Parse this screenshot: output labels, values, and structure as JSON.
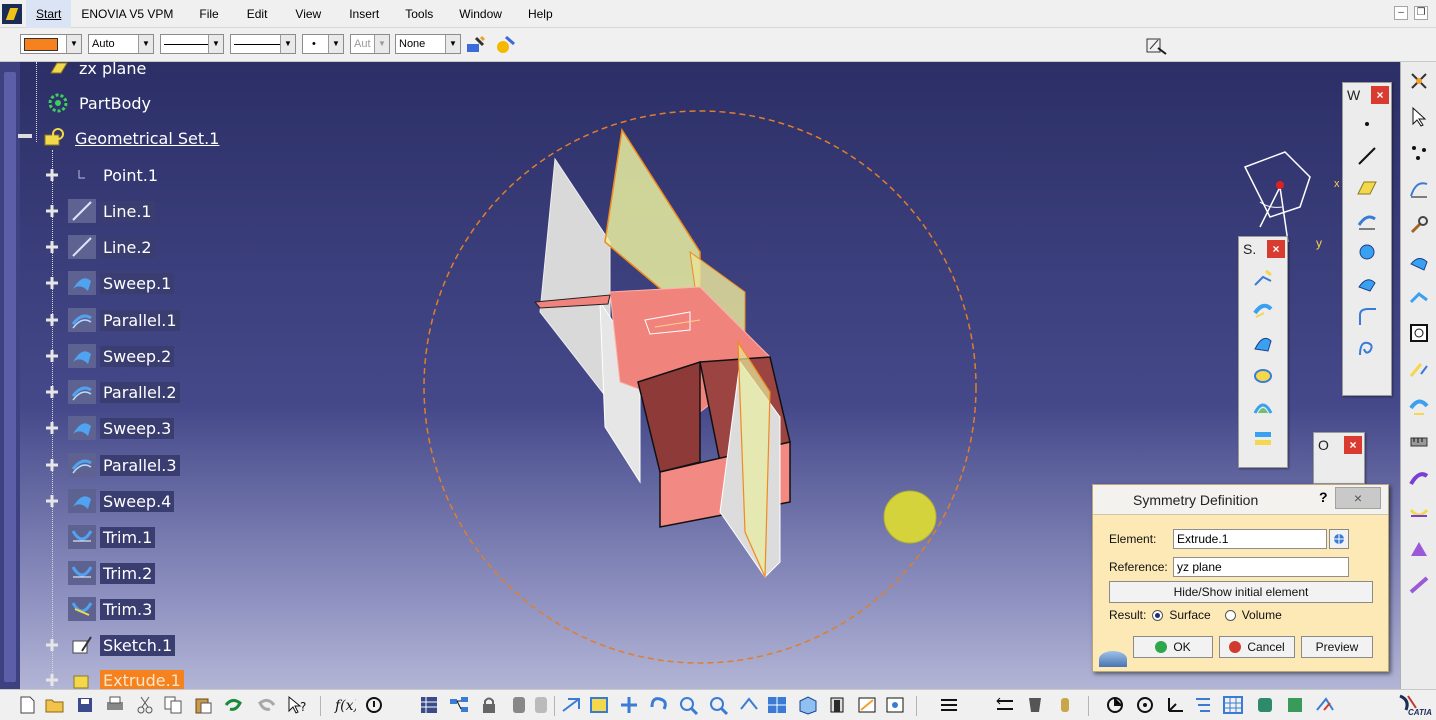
{
  "menubar": {
    "items": [
      "Start",
      "ENOVIA V5 VPM",
      "File",
      "Edit",
      "View",
      "Insert",
      "Tools",
      "Window",
      "Help"
    ]
  },
  "toolbar": {
    "linetype_value": "Auto",
    "weight_value": "Aut",
    "layer_value": "None",
    "dot_value": "•"
  },
  "tree": {
    "items": [
      {
        "label": "zx plane",
        "icon": "plane-icon"
      },
      {
        "label": "PartBody",
        "icon": "partbody-icon"
      },
      {
        "label": "Geometrical Set.1",
        "icon": "geometrical-set-icon"
      },
      {
        "label": "Point.1",
        "icon": "point-icon"
      },
      {
        "label": "Line.1",
        "icon": "line-icon"
      },
      {
        "label": "Line.2",
        "icon": "line-icon"
      },
      {
        "label": "Sweep.1",
        "icon": "sweep-icon"
      },
      {
        "label": "Parallel.1",
        "icon": "parallel-icon"
      },
      {
        "label": "Sweep.2",
        "icon": "sweep-icon"
      },
      {
        "label": "Parallel.2",
        "icon": "parallel-icon"
      },
      {
        "label": "Sweep.3",
        "icon": "sweep-icon"
      },
      {
        "label": "Parallel.3",
        "icon": "parallel-icon"
      },
      {
        "label": "Sweep.4",
        "icon": "sweep-icon"
      },
      {
        "label": "Trim.1",
        "icon": "trim-icon"
      },
      {
        "label": "Trim.2",
        "icon": "trim-icon"
      },
      {
        "label": "Trim.3",
        "icon": "trim-icon"
      },
      {
        "label": "Sketch.1",
        "icon": "sketch-icon"
      },
      {
        "label": "Extrude.1",
        "icon": "extrude-icon"
      }
    ]
  },
  "floating": {
    "wireframe_title": "W",
    "surfaces_title": "S.",
    "operations_title": "O"
  },
  "compass": {
    "axis_x": "x",
    "axis_y": "y"
  },
  "dialog": {
    "title": "Symmetry Definition",
    "help": "?",
    "close": "×",
    "element_label": "Element:",
    "element_value": "Extrude.1",
    "reference_label": "Reference:",
    "reference_value": "yz plane",
    "hide_show_label": "Hide/Show initial element",
    "result_label": "Result:",
    "surface_label": "Surface",
    "volume_label": "Volume",
    "ok_label": "OK",
    "cancel_label": "Cancel",
    "preview_label": "Preview"
  },
  "brand": {
    "catia": "CATIA"
  },
  "colors": {
    "accent": "#f5821f",
    "viewport_top": "#2c2f66",
    "dialog_bg": "#fde9b6"
  }
}
